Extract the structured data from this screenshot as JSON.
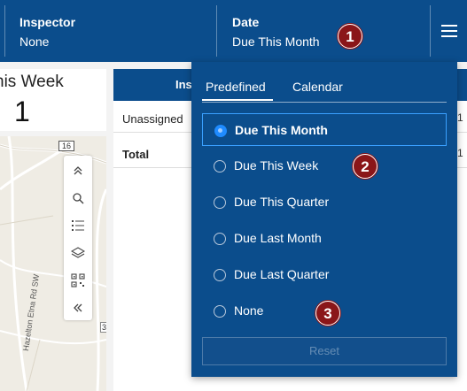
{
  "header": {
    "inspector_label": "Inspector",
    "inspector_value": "None",
    "date_label": "Date",
    "date_value": "Due This Month",
    "menu_icon": "hamburger-menu-icon"
  },
  "badges": [
    "1",
    "2",
    "3"
  ],
  "indicator": {
    "title": "his Week",
    "value": "1"
  },
  "map": {
    "route_shield": "16",
    "road_label": "Hazelton Etna Rd SW",
    "edge_label": "3",
    "toolbar": [
      "chevrons-up-icon",
      "search-icon",
      "list-icon",
      "layers-icon",
      "qr-code-icon",
      "chevrons-left-icon"
    ]
  },
  "table": {
    "header": "Ins",
    "rows": [
      {
        "label": "Unassigned",
        "edge": "1"
      },
      {
        "label": "Total",
        "edge": "1"
      }
    ]
  },
  "dropdown": {
    "tabs": [
      "Predefined",
      "Calendar"
    ],
    "active_tab": "Predefined",
    "options": [
      {
        "label": "Due This Month",
        "selected": true
      },
      {
        "label": "Due This Week",
        "selected": false
      },
      {
        "label": "Due This Quarter",
        "selected": false
      },
      {
        "label": "Due Last Month",
        "selected": false
      },
      {
        "label": "Due Last Quarter",
        "selected": false
      },
      {
        "label": "None",
        "selected": false
      }
    ],
    "reset_label": "Reset"
  },
  "colors": {
    "header_bg": "#0b4d8c",
    "badge": "#8a1619",
    "selection_outline": "#3aa0ff"
  }
}
